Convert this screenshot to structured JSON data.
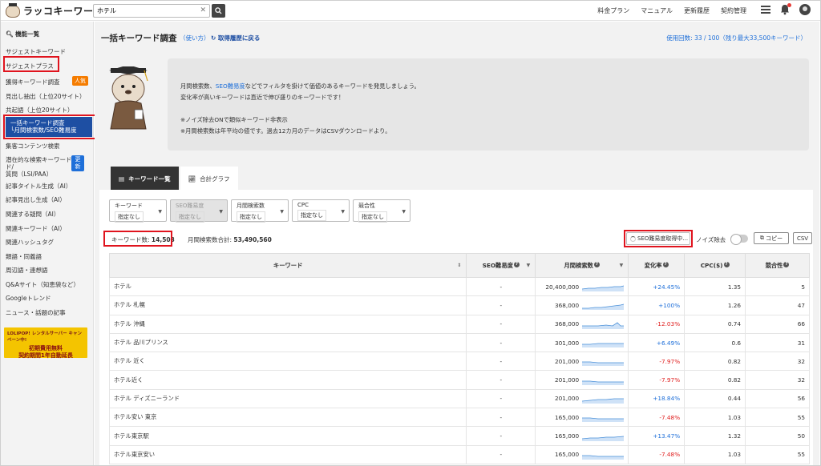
{
  "header": {
    "logo_text": "ラッコキーワード",
    "search_value": "ホテル",
    "nav": [
      "料金プラン",
      "マニュアル",
      "更新履歴",
      "契約管理"
    ]
  },
  "sidebar": {
    "heading": "機能一覧",
    "items": [
      {
        "label": "サジェストキーワード"
      },
      {
        "label": "サジェストプラス"
      },
      {
        "label": "獲得キーワード調査",
        "badge": "人気"
      },
      {
        "label": "見出し抽出（上位20サイト）"
      },
      {
        "label": "共起語（上位20サイト）"
      },
      {
        "label": "一括キーワード調査"
      },
      {
        "label": "集客コンテンツ検索"
      },
      {
        "label": "潜在的な検索キーワード/"
      },
      {
        "label": "記事タイトル生成（AI）"
      },
      {
        "label": "記事見出し生成（AI）"
      },
      {
        "label": "関連する疑問（AI）"
      },
      {
        "label": "関連キーワード（AI）"
      },
      {
        "label": "関連ハッシュタグ"
      },
      {
        "label": "類語・同義語"
      },
      {
        "label": "周辺語・連想語"
      },
      {
        "label": "Q&Aサイト（知恵袋など）"
      },
      {
        "label": "Googleトレンド"
      },
      {
        "label": "ニュース・話題の記事"
      }
    ],
    "active_line1": "一括キーワード調査",
    "active_line2": "└月間検索数/SEO難易度",
    "lsi_line2": "ド/",
    "lsi_line3": "質問（LSI/PAA）",
    "lsi_badge": "更新",
    "ad_top": "LOLIPOP! レンタルサーバー  キャンペーン中!",
    "ad_main_1": "初期費用無料",
    "ad_main_2": "契約期間1年自動延長"
  },
  "main": {
    "title": "一括キーワード調査",
    "howto": "（使い方）",
    "history": "取得履歴に戻る",
    "usage": "使用回数: 33 / 100（残り最大33,500キーワード）",
    "intro_1a": "月間検索数、",
    "intro_1b": "SEO難易度",
    "intro_1c": "などでフィルタを掛けて価値のあるキーワードを発見しましょう。",
    "intro_2": "変化率が高いキーワードは直近で伸び盛りのキーワードです！",
    "intro_3": "※ノイズ除去ONで類似キーワード非表示",
    "intro_4": "※月間検索数は年平均の値です。過去12カ月のデータはCSVダウンロードより。",
    "tabs": [
      "キーワード一覧",
      "合計グラフ"
    ],
    "filters": [
      {
        "label": "キーワード",
        "value": "指定なし",
        "disabled": false
      },
      {
        "label": "SEO難易度",
        "value": "指定なし",
        "disabled": true
      },
      {
        "label": "月間検索数",
        "value": "指定なし",
        "disabled": false
      },
      {
        "label": "CPC",
        "value": "指定なし",
        "disabled": false
      },
      {
        "label": "競合性",
        "value": "指定なし",
        "disabled": false
      }
    ],
    "kw_count_label": "キーワード数:",
    "kw_count": "14,503",
    "vol_sum_label": "月間検索数合計:",
    "vol_sum": "53,490,560",
    "seo_status": "SEO難易度取得中...",
    "noise_label": "ノイズ除去",
    "copy_label": "コピー",
    "csv_label": "CSV",
    "columns": [
      "キーワード",
      "SEO難易度",
      "月間検索数",
      "変化率",
      "CPC($)",
      "競合性"
    ],
    "rows": [
      {
        "kw": "ホテル",
        "seo": "-",
        "vol": "20,400,000",
        "chg": "+24.45%",
        "cpc": "1.35",
        "comp": "5"
      },
      {
        "kw": "ホテル 札幌",
        "seo": "-",
        "vol": "368,000",
        "chg": "+100%",
        "cpc": "1.26",
        "comp": "47"
      },
      {
        "kw": "ホテル 沖縄",
        "seo": "-",
        "vol": "368,000",
        "chg": "-12.03%",
        "cpc": "0.74",
        "comp": "66"
      },
      {
        "kw": "ホテル 品川プリンス",
        "seo": "-",
        "vol": "301,000",
        "chg": "+6.49%",
        "cpc": "0.6",
        "comp": "31"
      },
      {
        "kw": "ホテル 近く",
        "seo": "-",
        "vol": "201,000",
        "chg": "-7.97%",
        "cpc": "0.82",
        "comp": "32"
      },
      {
        "kw": "ホテル近く",
        "seo": "-",
        "vol": "201,000",
        "chg": "-7.97%",
        "cpc": "0.82",
        "comp": "32"
      },
      {
        "kw": "ホテル ディズニーランド",
        "seo": "-",
        "vol": "201,000",
        "chg": "+18.84%",
        "cpc": "0.44",
        "comp": "56"
      },
      {
        "kw": "ホテル安い 東京",
        "seo": "-",
        "vol": "165,000",
        "chg": "-7.48%",
        "cpc": "1.03",
        "comp": "55"
      },
      {
        "kw": "ホテル東京駅",
        "seo": "-",
        "vol": "165,000",
        "chg": "+13.47%",
        "cpc": "1.32",
        "comp": "50"
      },
      {
        "kw": "ホテル東京安い",
        "seo": "-",
        "vol": "165,000",
        "chg": "-7.48%",
        "cpc": "1.03",
        "comp": "55"
      }
    ]
  },
  "colors": {
    "accent_blue": "#1e6fd9",
    "sidebar_active": "#1e4fa3",
    "highlight_red": "#e0141e",
    "positive": "#1e6fd9",
    "negative": "#e02020"
  }
}
